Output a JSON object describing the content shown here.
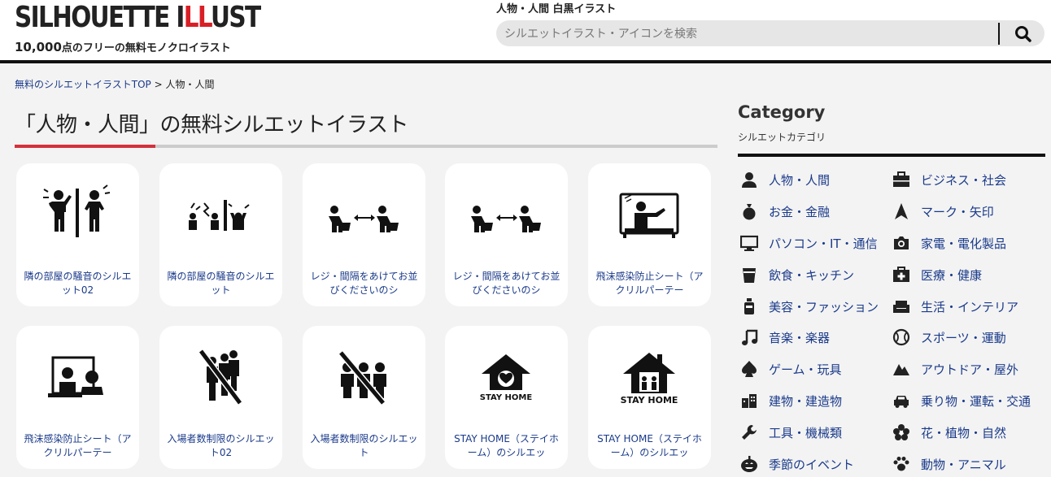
{
  "header": {
    "logo_part1": "SILHOUETTE I",
    "logo_part2": "LL",
    "logo_part3": "UST",
    "tagline_count": "10,000",
    "tagline_rest": "点のフリーの無料モノクロイラスト",
    "topic": "人物・人間 白黒イラスト",
    "search_placeholder": "シルエットイラスト・アイコンを検索"
  },
  "breadcrumb": {
    "home": "無料のシルエットイラストTOP",
    "sep": " > ",
    "current": "人物・人間"
  },
  "page_title": "「人物・人間」の無料シルエットイラスト",
  "cards": [
    {
      "caption": "隣の部屋の騒音のシルエット02",
      "icon": "neighbor-noise-icon"
    },
    {
      "caption": "隣の部屋の騒音のシルエット",
      "icon": "neighbor-noise-icon"
    },
    {
      "caption": "レジ・間隔をあけてお並びくださいのシ",
      "icon": "register-distance-icon"
    },
    {
      "caption": "レジ・間隔をあけてお並びくださいのシ",
      "icon": "register-distance-icon"
    },
    {
      "caption": "飛沫感染防止シート（アクリルパーテー",
      "icon": "acrylic-partition-icon"
    },
    {
      "caption": "飛沫感染防止シート（アクリルパーテー",
      "icon": "acrylic-partition-icon"
    },
    {
      "caption": "入場者数制限のシルエット02",
      "icon": "entry-limit-icon"
    },
    {
      "caption": "入場者数制限のシルエット",
      "icon": "entry-limit-icon"
    },
    {
      "caption": "STAY HOME（ステイホーム）のシルエッ",
      "icon": "stay-home-icon",
      "badge": "STAY HOME"
    },
    {
      "caption": "STAY HOME（ステイホーム）のシルエッ",
      "icon": "stay-home-icon",
      "badge": "STAY HOME"
    }
  ],
  "sidebar": {
    "title": "Category",
    "subtitle": "シルエットカテゴリ",
    "categories": [
      {
        "label": "人物・人間",
        "icon": "person-icon"
      },
      {
        "label": "ビジネス・社会",
        "icon": "briefcase-icon"
      },
      {
        "label": "お金・金融",
        "icon": "money-bag-icon"
      },
      {
        "label": "マーク・矢印",
        "icon": "arrow-icon"
      },
      {
        "label": "パソコン・IT・通信",
        "icon": "monitor-icon"
      },
      {
        "label": "家電・電化製品",
        "icon": "camera-icon"
      },
      {
        "label": "飲食・キッチン",
        "icon": "cup-icon"
      },
      {
        "label": "医療・健康",
        "icon": "medical-kit-icon"
      },
      {
        "label": "美容・ファッション",
        "icon": "bottle-icon"
      },
      {
        "label": "生活・インテリア",
        "icon": "sofa-icon"
      },
      {
        "label": "音楽・楽器",
        "icon": "music-note-icon"
      },
      {
        "label": "スポーツ・運動",
        "icon": "ball-icon"
      },
      {
        "label": "ゲーム・玩具",
        "icon": "spade-icon"
      },
      {
        "label": "アウトドア・屋外",
        "icon": "mountain-icon"
      },
      {
        "label": "建物・建造物",
        "icon": "building-icon"
      },
      {
        "label": "乗り物・運転・交通",
        "icon": "car-icon"
      },
      {
        "label": "工具・機械類",
        "icon": "wrench-icon"
      },
      {
        "label": "花・植物・自然",
        "icon": "flower-icon"
      },
      {
        "label": "季節のイベント",
        "icon": "pumpkin-icon"
      },
      {
        "label": "動物・アニマル",
        "icon": "paw-icon"
      }
    ]
  },
  "colors": {
    "accent_red": "#d2323c",
    "link_blue": "#1a3a8a"
  }
}
